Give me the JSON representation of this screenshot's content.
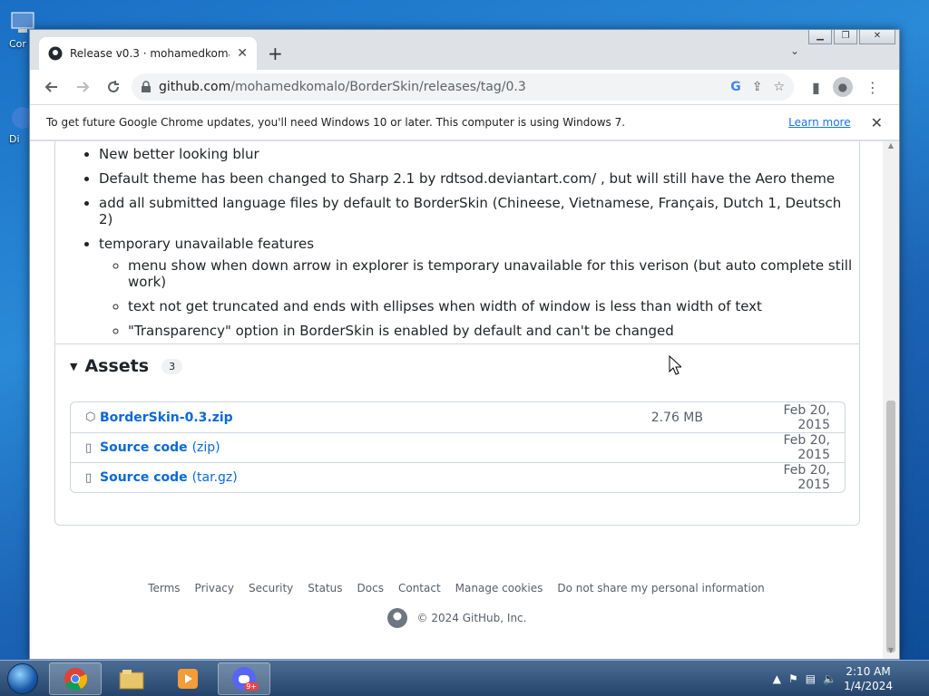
{
  "desktop": {
    "icons": [
      {
        "label": "Cor",
        "icon": "computer-icon"
      },
      {
        "label": "Di",
        "icon": "app-icon"
      }
    ]
  },
  "browser": {
    "tab_title": "Release v0.3 · mohamedkomalo/",
    "tab_close": "✕",
    "new_tab": "+",
    "url_host": "github.com",
    "url_path": "/mohamedkomalo/BorderSkin/releases/tag/0.3",
    "infobar_message": "To get future Google Chrome updates, you'll need Windows 10 or later. This computer is using Windows 7.",
    "infobar_link": "Learn more"
  },
  "release": {
    "bullets": [
      "New better looking blur",
      "Default theme has been changed to Sharp 2.1 by rdtsod.deviantart.com/ , but will still have the Aero theme",
      "add all submitted language files by default to BorderSkin (Chineese, Vietnamese, Français, Dutch 1, Deutsch 2)",
      "temporary unavailable features"
    ],
    "sub_bullets": [
      "menu show when down arrow in explorer is temporary unavailable for this verison (but auto complete still work)",
      "text not get truncated and ends with ellipses when width of window is less than width of text",
      "\"Transparency\" option in BorderSkin is enabled by default and can't be changed"
    ],
    "assets_label": "Assets",
    "assets_count": "3",
    "assets": [
      {
        "name": "BorderSkin-0.3.zip",
        "suffix": "",
        "size": "2.76 MB",
        "date": "Feb 20, 2015",
        "icon": "package-icon"
      },
      {
        "name": "Source code",
        "suffix": "(zip)",
        "size": "",
        "date": "Feb 20, 2015",
        "icon": "file-zip-icon"
      },
      {
        "name": "Source code",
        "suffix": "(tar.gz)",
        "size": "",
        "date": "Feb 20, 2015",
        "icon": "file-zip-icon"
      }
    ]
  },
  "footer": {
    "links": [
      "Terms",
      "Privacy",
      "Security",
      "Status",
      "Docs",
      "Contact",
      "Manage cookies",
      "Do not share my personal information"
    ],
    "copyright": "© 2024 GitHub, Inc."
  },
  "taskbar": {
    "apps": [
      "chrome-icon",
      "explorer-icon",
      "media-player-icon",
      "discord-icon"
    ],
    "discord_badge": "9+",
    "time": "2:10 AM",
    "date": "1/4/2024"
  }
}
